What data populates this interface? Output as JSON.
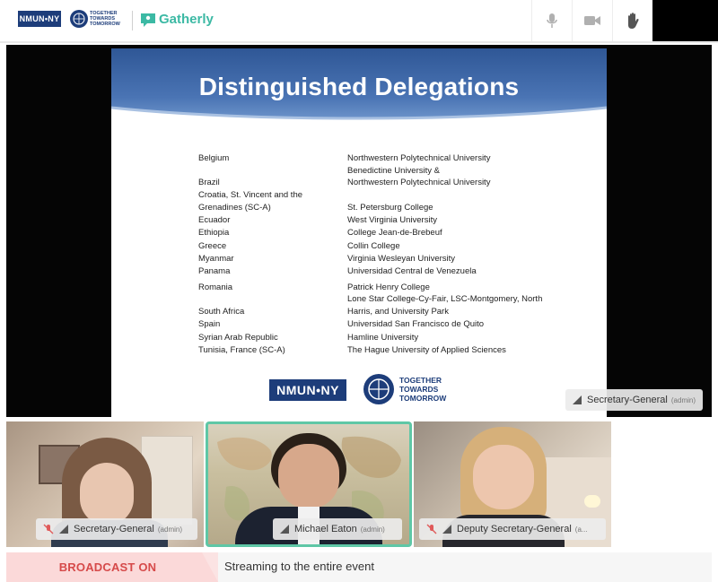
{
  "topbar": {
    "nmun_logo": "NMUN•NY",
    "ttt_logo": [
      "TOGETHER",
      "TOWARDS",
      "TOMORROW"
    ],
    "app_name": "Gatherly",
    "controls": [
      "microphone-icon",
      "camera-icon",
      "raise-hand-icon"
    ]
  },
  "slide": {
    "title": "Distinguished Delegations",
    "left": [
      "Belgium",
      "Brazil",
      "Croatia, St. Vincent and the",
      "Grenadines (SC-A)",
      "Ecuador",
      "Ethiopia",
      "Greece",
      "Myanmar",
      "Panama",
      "Romania",
      "South Africa",
      "Spain",
      "Syrian Arab Republic",
      "Tunisia, France (SC-A)"
    ],
    "right": [
      "Northwestern Polytechnical University",
      "Benedictine University &",
      "Northwestern Polytechnical University",
      "St. Petersburg College",
      "West Virginia University",
      "College Jean-de-Brebeuf",
      "Collin College",
      "Virginia Wesleyan University",
      "Universidad Central de Venezuela",
      "Patrick Henry College",
      "Lone Star College-Cy-Fair, LSC-Montgomery, North",
      "Harris, and University Park",
      "Universidad San Francisco de Quito",
      "Hamline University",
      "The Hague University of Applied Sciences"
    ],
    "nmun_logo": "NMUN•NY",
    "ttt_logo": [
      "TOGETHER",
      "TOWARDS",
      "TOMORROW"
    ]
  },
  "main_tag": {
    "name": "Secretary-General",
    "role": "(admin)"
  },
  "tiles": [
    {
      "name": "Secretary-General",
      "role": "(admin)",
      "muted": true
    },
    {
      "name": "Michael Eaton",
      "role": "(admin)",
      "muted": false
    },
    {
      "name": "Deputy Secretary-General",
      "role": "(a...",
      "muted": true
    }
  ],
  "broadcast": {
    "label": "BROADCAST ON",
    "status": "Streaming to the entire event"
  },
  "colors": {
    "accent": "#3cb9a4",
    "active_border": "#5fc7a6",
    "broadcast": "#d64a4a",
    "slide_header": "#4a74b4",
    "nmun_blue": "#1d3d7a"
  }
}
